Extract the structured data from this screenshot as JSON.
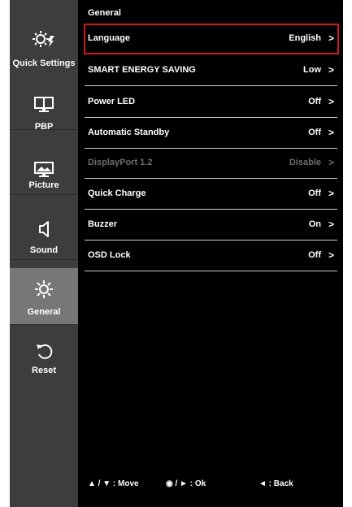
{
  "sidebar": {
    "items": [
      {
        "label": "Quick Settings",
        "icon": "quick-settings-icon"
      },
      {
        "label": "PBP",
        "icon": "pbp-icon"
      },
      {
        "label": "Picture",
        "icon": "picture-icon"
      },
      {
        "label": "Sound",
        "icon": "speaker-icon"
      },
      {
        "label": "General",
        "icon": "gear-icon"
      },
      {
        "label": "Reset",
        "icon": "reset-icon"
      }
    ],
    "active": "General"
  },
  "main": {
    "title": "General",
    "rows": [
      {
        "name": "Language",
        "value": "English"
      },
      {
        "name": "SMART ENERGY SAVING",
        "value": "Low"
      },
      {
        "name": "Power LED",
        "value": "Off"
      },
      {
        "name": "Automatic Standby",
        "value": "Off"
      },
      {
        "name": "DisplayPort 1.2",
        "value": "Disable"
      },
      {
        "name": "Quick Charge",
        "value": "Off"
      },
      {
        "name": "Buzzer",
        "value": "On"
      },
      {
        "name": "OSD Lock",
        "value": "Off"
      }
    ],
    "chevron": ">"
  },
  "footer": {
    "move": "▲ / ▼ : Move",
    "ok": "◉ / ► : Ok",
    "back": "◄ : Back"
  },
  "colors": {
    "sidebar_bg": "#3d3d3d",
    "active_bg": "#777777",
    "selection_border": "#d0171e",
    "disabled_text": "#6d6d6d"
  }
}
